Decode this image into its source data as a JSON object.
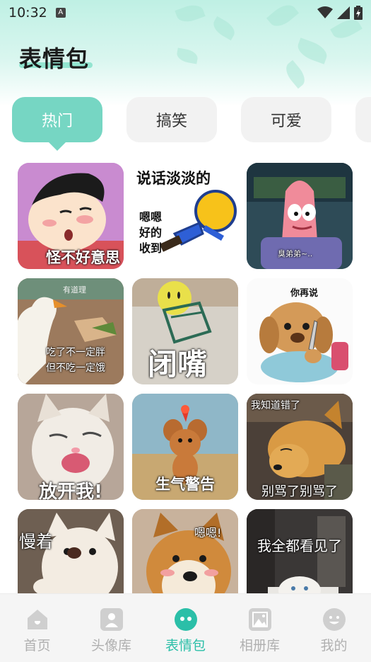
{
  "status_bar": {
    "time": "10:32",
    "notif_icon": "a-icon",
    "icons": [
      "wifi-icon",
      "signal-icon",
      "battery-icon"
    ]
  },
  "header": {
    "title": "表情包"
  },
  "tabs": [
    {
      "label": "热门",
      "active": true
    },
    {
      "label": "搞笑",
      "active": false
    },
    {
      "label": "可爱",
      "active": false
    }
  ],
  "stickers": [
    {
      "caption": "怪不好意思",
      "subject": "cartoon boy"
    },
    {
      "caption": "说话淡淡的",
      "caption2": "嗯嗯\n好的\n收到",
      "subject": "smiley figure"
    },
    {
      "caption": "臭弟弟~..",
      "subject": "starfish"
    },
    {
      "caption": "有道理",
      "caption2": "吃了不一定胖\n但不吃一定饿",
      "subject": "goose"
    },
    {
      "caption": "闭嘴",
      "subject": "clip smiley"
    },
    {
      "caption": "你再说",
      "subject": "toy dog with knife"
    },
    {
      "caption": "放开我!",
      "subject": "kitten"
    },
    {
      "caption": "生气警告",
      "subject": "jerry mouse"
    },
    {
      "caption": "我知道错了",
      "caption2": "别骂了别骂了",
      "subject": "shiba"
    },
    {
      "caption": "慢着",
      "subject": "white dog"
    },
    {
      "caption": "嗯嗯!",
      "subject": "shiba close-up"
    },
    {
      "caption": "我全都看见了",
      "subject": "cat in room"
    }
  ],
  "bottom_nav": [
    {
      "label": "首页",
      "icon": "home-icon",
      "active": false
    },
    {
      "label": "头像库",
      "icon": "avatar-icon",
      "active": false
    },
    {
      "label": "表情包",
      "icon": "sticker-icon",
      "active": true
    },
    {
      "label": "相册库",
      "icon": "album-icon",
      "active": false
    },
    {
      "label": "我的",
      "icon": "profile-icon",
      "active": false
    }
  ],
  "colors": {
    "accent": "#76d6c3",
    "nav_active": "#2bbfa8",
    "nav_inactive": "#b0b0b0"
  }
}
